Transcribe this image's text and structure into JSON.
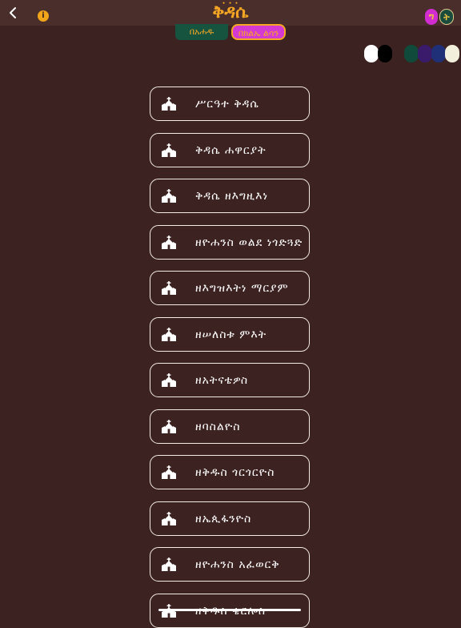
{
  "header": {
    "title": "ቅዳሴ",
    "back_icon": "chevron-left-icon",
    "info_icon": "info-icon",
    "info_glyph": "i",
    "lang_buttons": [
      {
        "label": "ግ",
        "color": "#d02cd0"
      },
      {
        "label": "ት",
        "color": "#1a4c3d"
      }
    ]
  },
  "tabs": [
    {
      "label": "በአሐዱ",
      "color": "#17543f"
    },
    {
      "label": "በክልኤ ልሳን",
      "color": "#d43ad1"
    }
  ],
  "theme_swatches": [
    "#ffffff",
    "#000000",
    "#0f4a3a",
    "#3a1a6a",
    "#1f2f78",
    "#f2efdd"
  ],
  "menu": {
    "item_icon": "church-icon",
    "items": [
      {
        "label": "ሥርዓተ ቅዳሴ"
      },
      {
        "label": "ቅዳሴ ሐዋርያት"
      },
      {
        "label": "ቅዳሴ ዘእግዚእነ"
      },
      {
        "label": "ዘዮሐንስ ወልደ ነጎድጓድ"
      },
      {
        "label": "ዘእግዝእትነ ማርያም"
      },
      {
        "label": "ዘሠለስቱ ምእት"
      },
      {
        "label": "ዘአትናቴዎስ"
      },
      {
        "label": "ዘባስልዮስ"
      },
      {
        "label": "ዘቅዱስ ጎርጎርዮስ"
      },
      {
        "label": "ዘኤጲፋንዮስ"
      },
      {
        "label": "ዘዮሐንስ አፈወርቅ"
      },
      {
        "label": "ዘቅዱስ ቄርሎስ"
      }
    ]
  },
  "colors": {
    "background": "#3c2220",
    "header": "#4a2e2b",
    "accent": "#f5a623",
    "button_border": "#f3ebe6"
  }
}
